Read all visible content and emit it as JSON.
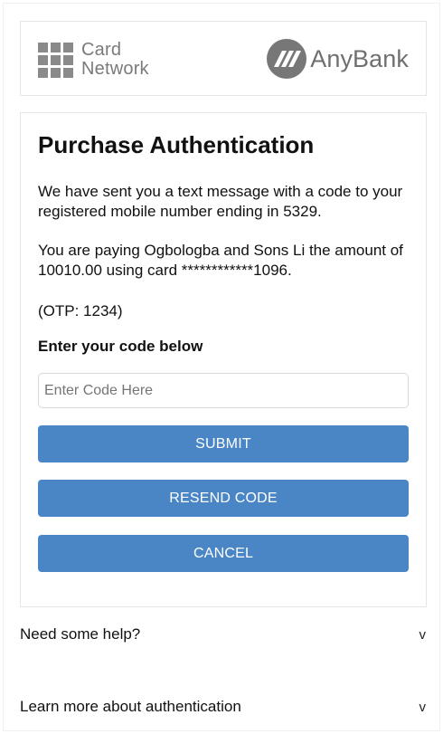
{
  "brands": {
    "card_network_line1": "Card",
    "card_network_line2": "Network",
    "bank_name": "AnyBank",
    "icon_color": "#777777"
  },
  "auth": {
    "title": "Purchase Authentication",
    "message_sent": "We have sent you a text message with a code to your registered mobile number ending in 5329.",
    "payment_details": "You are paying Ogbologba and Sons Li the amount of 10010.00 using card ************1096.",
    "otp_hint": "(OTP: 1234)",
    "code_label": "Enter your code below",
    "code_placeholder": "Enter Code Here",
    "code_value": ""
  },
  "buttons": {
    "submit": "SUBMIT",
    "resend": "RESEND CODE",
    "cancel": "CANCEL",
    "color": "#4a86c5"
  },
  "help": {
    "need_help": "Need some help?",
    "learn_more": "Learn more about authentication",
    "expand_glyph": "v"
  }
}
